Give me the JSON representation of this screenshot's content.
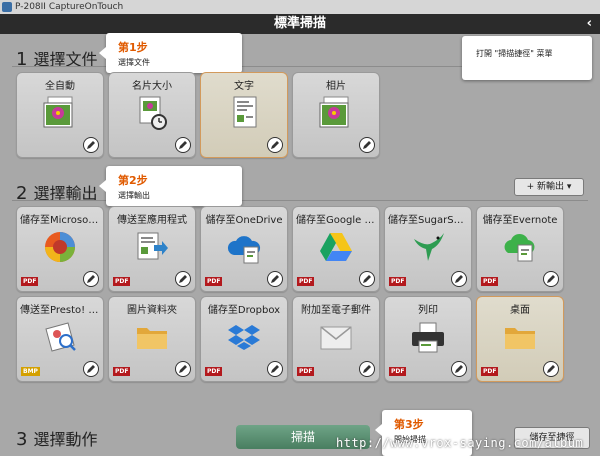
{
  "window": {
    "title": "P-208II CaptureOnTouch"
  },
  "header": {
    "title": "標準掃描",
    "close_glyph": "‹"
  },
  "tooltip_shortcut": {
    "text": "打開 \"掃描捷徑\" 菜單"
  },
  "section1": {
    "num": "1",
    "title": "選擇文件",
    "tip": {
      "step": "第1步",
      "desc": "選擇文件"
    },
    "tiles": [
      {
        "label": "全自動",
        "icon": "photo-stack-icon"
      },
      {
        "label": "名片大小",
        "icon": "card-clock-icon"
      },
      {
        "label": "文字",
        "icon": "text-document-icon",
        "selected": true
      },
      {
        "label": "相片",
        "icon": "photo-stack-icon"
      }
    ]
  },
  "section2": {
    "num": "2",
    "title": "選擇輸出",
    "tip": {
      "step": "第2步",
      "desc": "選擇輸出"
    },
    "new_output": "+ 新輸出 ▾",
    "tiles": [
      {
        "label": "儲存至Microsoft ...",
        "icon": "onenote-icon",
        "badge": "PDF"
      },
      {
        "label": "傳送至應用程式",
        "icon": "send-app-icon",
        "badge": "PDF"
      },
      {
        "label": "儲存至OneDrive",
        "icon": "onedrive-icon",
        "badge": "PDF"
      },
      {
        "label": "儲存至Google D...",
        "icon": "google-drive-icon",
        "badge": "PDF"
      },
      {
        "label": "儲存至SugarSync",
        "icon": "sugarsync-icon",
        "badge": "PDF"
      },
      {
        "label": "儲存至Evernote",
        "icon": "evernote-icon",
        "badge": "PDF"
      },
      {
        "label": "傳送至Presto! Bi...",
        "icon": "presto-icon",
        "badge": "BMP"
      },
      {
        "label": "圖片資料夾",
        "icon": "folder-icon",
        "badge": "PDF"
      },
      {
        "label": "儲存至Dropbox",
        "icon": "dropbox-icon",
        "badge": "PDF"
      },
      {
        "label": "附加至電子郵件",
        "icon": "email-icon",
        "badge": "PDF"
      },
      {
        "label": "列印",
        "icon": "printer-icon",
        "badge": "PDF"
      },
      {
        "label": "桌面",
        "icon": "folder-icon",
        "badge": "PDF",
        "selected": true
      }
    ]
  },
  "section3": {
    "num": "3",
    "title": "選擇動作",
    "tip": {
      "step": "第3步",
      "desc": "開始掃描"
    },
    "scan_button": "掃描",
    "save_shortcut": "儲存至捷徑"
  },
  "watermark": "http://www.vrox-saying.com/album"
}
